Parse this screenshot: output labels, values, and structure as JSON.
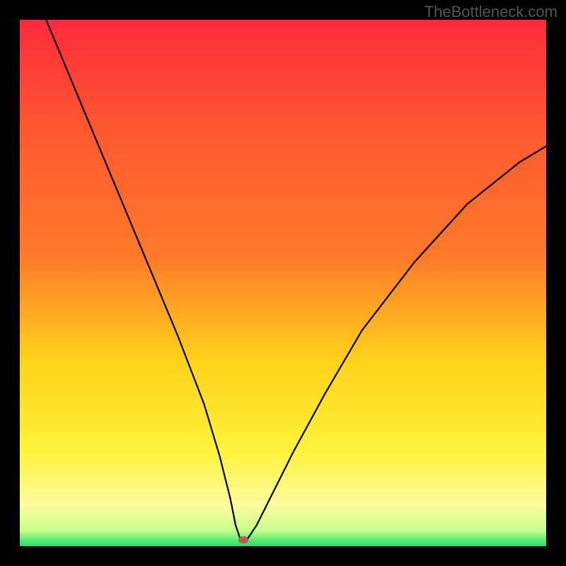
{
  "watermark": "TheBottleneck.com",
  "chart_data": {
    "type": "line",
    "title": "",
    "xlabel": "",
    "ylabel": "",
    "xlim": [
      0,
      100
    ],
    "ylim": [
      0,
      100
    ],
    "gradient_colors": {
      "top": "#ff2a3c",
      "upper_mid": "#ff7a2a",
      "mid": "#ffd31a",
      "lower_mid": "#fff33a",
      "low": "#fffba0",
      "bottom": "#18e06a"
    },
    "series": [
      {
        "name": "bottleneck-curve",
        "x": [
          5,
          10,
          15,
          20,
          25,
          30,
          35,
          38,
          40,
          41,
          42,
          43,
          45,
          48,
          52,
          58,
          65,
          75,
          85,
          95,
          100
        ],
        "y": [
          100,
          88,
          76,
          64,
          52,
          40,
          27,
          17,
          9,
          4,
          1,
          1,
          4,
          10,
          18,
          29,
          41,
          54,
          65,
          73,
          76
        ]
      }
    ],
    "marker": {
      "x": 42.5,
      "y": 1.2,
      "color": "#c05a5a"
    }
  }
}
